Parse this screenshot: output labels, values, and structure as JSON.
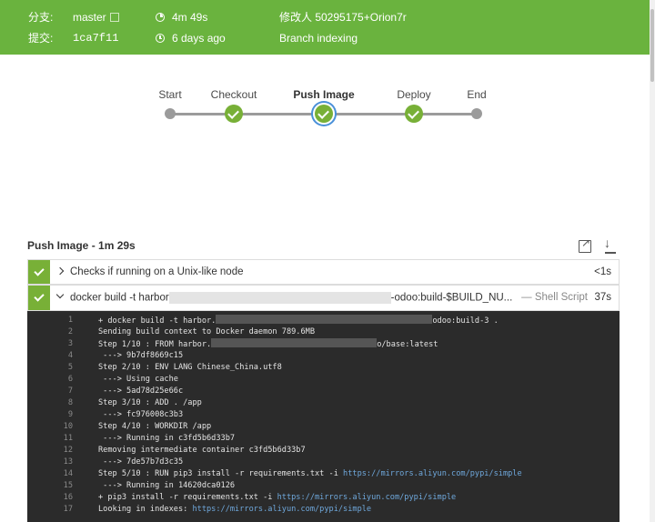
{
  "header": {
    "branch_key": "分支:",
    "branch_val": "master",
    "commit_key": "提交:",
    "commit_val": "1ca7f11",
    "duration": "4m 49s",
    "ago": "6 days ago",
    "modifier": "修改人 50295175+Orion7r",
    "cause": "Branch indexing",
    "bg_color": "#6ab33e"
  },
  "pipeline": {
    "stages": [
      {
        "label": "Start",
        "status": "none"
      },
      {
        "label": "Checkout",
        "status": "success"
      },
      {
        "label": "Push Image",
        "status": "success-selected"
      },
      {
        "label": "Deploy",
        "status": "success"
      },
      {
        "label": "End",
        "status": "none"
      }
    ]
  },
  "section": {
    "title": "Push Image - 1m 29s",
    "open_icon": "open-external-icon",
    "download_icon": "download-icon"
  },
  "steps": [
    {
      "text": "Checks if running on a Unix-like node",
      "duration": "<1s",
      "expanded": false
    },
    {
      "text_prefix": "docker build -t harbor",
      "text_suffix": "-odoo:build-$BUILD_NU...",
      "type": "— Shell Script",
      "duration": "37s",
      "expanded": true
    }
  ],
  "console": [
    {
      "n": "1",
      "a": "+ docker build -t harbor.",
      "b": "odoo:build-3 ."
    },
    {
      "n": "2",
      "a": "Sending build context to Docker daemon  789.6MB"
    },
    {
      "n": "3",
      "a": "Step 1/10 : FROM harbor.",
      "b": "o/base:latest"
    },
    {
      "n": "4",
      "a": " ---> 9b7df8669c15"
    },
    {
      "n": "5",
      "a": "Step 2/10 : ENV LANG Chinese_China.utf8"
    },
    {
      "n": "6",
      "a": " ---> Using cache"
    },
    {
      "n": "7",
      "a": " ---> 5ad78d25e66c"
    },
    {
      "n": "8",
      "a": "Step 3/10 : ADD . /app"
    },
    {
      "n": "9",
      "a": " ---> fc976008c3b3"
    },
    {
      "n": "10",
      "a": "Step 4/10 : WORKDIR /app"
    },
    {
      "n": "11",
      "a": " ---> Running in c3fd5b6d33b7"
    },
    {
      "n": "12",
      "a": "Removing intermediate container c3fd5b6d33b7"
    },
    {
      "n": "13",
      "a": " ---> 7de57b7d3c35"
    },
    {
      "n": "14",
      "a": "Step 5/10 : RUN pip3 install -r requirements.txt -i ",
      "link": "https://mirrors.aliyun.com/pypi/simple"
    },
    {
      "n": "15",
      "a": " ---> Running in 14620dca0126"
    },
    {
      "n": "16",
      "a": "+ pip3 install -r requirements.txt -i ",
      "link": "https://mirrors.aliyun.com/pypi/simple"
    },
    {
      "n": "17",
      "a": "Looking in indexes: ",
      "link": "https://mirrors.aliyun.com/pypi/simple"
    }
  ]
}
